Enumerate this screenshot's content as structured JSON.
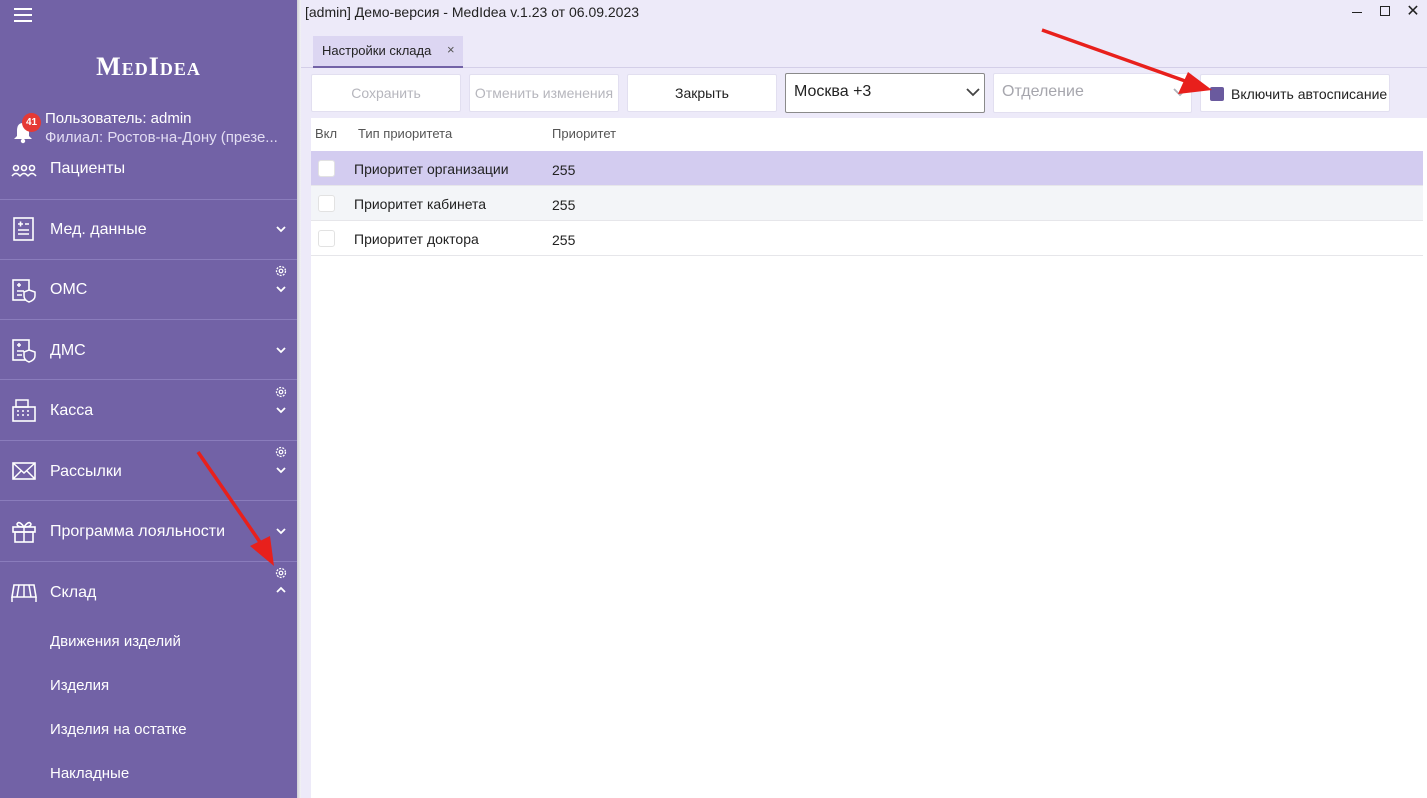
{
  "app": {
    "title": "[admin] Демо-версия  - MedIdea v.1.23 от 06.09.2023",
    "logo": "MedIdea"
  },
  "user": {
    "notifications": "41",
    "user_label": "Пользователь: admin",
    "branch_label": "Филиал: Ростов-на-Дону (презе..."
  },
  "sidebar": {
    "items": [
      {
        "label": "Пациенты",
        "icon": "patients-icon"
      },
      {
        "label": "Мед. данные",
        "icon": "medical-data-icon"
      },
      {
        "label": "ОМС",
        "icon": "oms-icon"
      },
      {
        "label": "ДМС",
        "icon": "dms-icon"
      },
      {
        "label": "Касса",
        "icon": "cash-register-icon"
      },
      {
        "label": "Рассылки",
        "icon": "mail-icon"
      },
      {
        "label": "Программа лояльности",
        "icon": "gift-icon"
      },
      {
        "label": "Склад",
        "icon": "warehouse-icon"
      }
    ],
    "warehouse_sub": [
      "Движения изделий",
      "Изделия",
      "Изделия на остатке",
      "Накладные"
    ]
  },
  "tabs": [
    {
      "label": "Настройки склада",
      "close": "×"
    }
  ],
  "toolbar": {
    "save_label": "Сохранить",
    "cancel_label": "Отменить изменения",
    "close_label": "Закрыть",
    "timezone_value": "Москва +3",
    "department_placeholder": "Отделение",
    "autowriteoff_label": "Включить автосписание",
    "autowriteoff_checked": true
  },
  "table": {
    "headers": [
      "Вкл",
      "Тип приоритета",
      "Приоритет"
    ],
    "rows": [
      {
        "enabled": false,
        "type": "Приоритет организации",
        "priority": "255"
      },
      {
        "enabled": false,
        "type": "Приоритет кабинета",
        "priority": "255"
      },
      {
        "enabled": false,
        "type": "Приоритет доктора",
        "priority": "255"
      }
    ]
  },
  "colors": {
    "sidebar": "#7262a6",
    "accent": "#6a5a9e",
    "selected_row": "#d3ccf0",
    "annotation_arrow": "#e8201c"
  }
}
